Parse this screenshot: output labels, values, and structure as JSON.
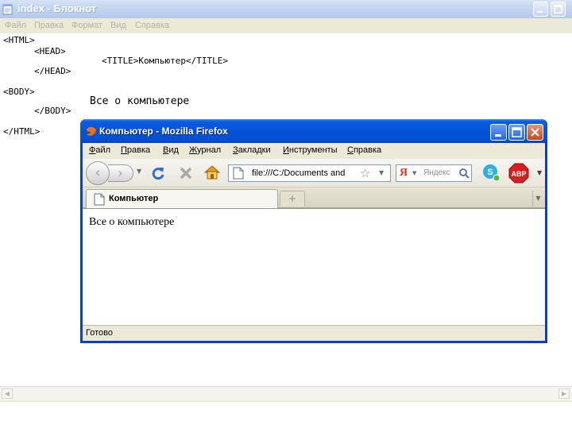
{
  "notepad": {
    "title": "index - Блокнот",
    "menu": [
      "Файл",
      "Правка",
      "Формат",
      "Вид",
      "Справка"
    ],
    "lines": [
      "<HTML>",
      "<HEAD>",
      "<TITLE>Компьютер</TITLE>",
      "</HEAD>",
      "<BODY>",
      "Все о компьютере",
      "</BODY>",
      "</HTML>"
    ]
  },
  "firefox": {
    "title": "Компьютер - Mozilla Firefox",
    "menu": [
      {
        "label": "Файл",
        "accel": "Ф",
        "rest": "айл"
      },
      {
        "label": "Правка",
        "accel": "П",
        "rest": "равка"
      },
      {
        "label": "Вид",
        "accel": "В",
        "rest": "ид"
      },
      {
        "label": "Журнал",
        "accel": "Ж",
        "rest": "урнал"
      },
      {
        "label": "Закладки",
        "accel": "З",
        "rest": "акладки"
      },
      {
        "label": "Инструменты",
        "accel": "И",
        "rest": "нструменты"
      },
      {
        "label": "Справка",
        "accel": "С",
        "rest": "правка"
      }
    ],
    "url": "file:///C:/Documents and Settings",
    "search_engine_letter": "Я",
    "search_placeholder": "Яндекс",
    "tab_title": "Компьютер",
    "newtab_symbol": "+",
    "page_text": "Все о компьютере",
    "status": "Готово",
    "abp_label": "ABP"
  },
  "colors": {
    "xp_title_blue": "#0553d8",
    "content_bg": "#ffffff",
    "chrome_bg": "#ece9d8",
    "yandex_red": "#e4301b"
  }
}
